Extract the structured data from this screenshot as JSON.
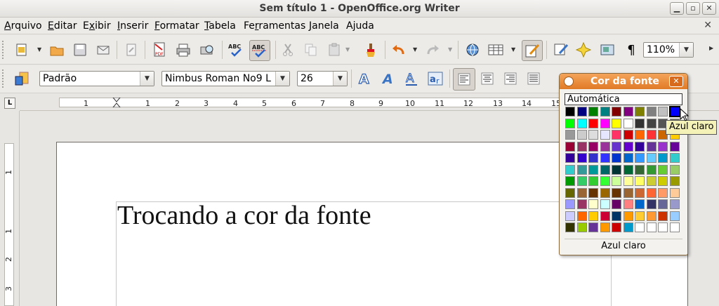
{
  "window": {
    "title": "Sem título 1 - OpenOffice.org Writer",
    "btn_min": "▁",
    "btn_max": "▫",
    "btn_close": "✕",
    "doc_close": "✕"
  },
  "menu": [
    {
      "label": "Arquivo",
      "accel": "A",
      "rest": "rquivo"
    },
    {
      "label": "Editar",
      "accel": "E",
      "rest": "ditar"
    },
    {
      "label": "Exibir",
      "accel": "x",
      "rest": "ibir"
    },
    {
      "label": "Inserir",
      "accel": "I",
      "rest": "nserir"
    },
    {
      "label": "Formatar",
      "accel": "F",
      "rest": "ormatar"
    },
    {
      "label": "Tabela",
      "accel": "T",
      "rest": "abela"
    },
    {
      "label": "Ferramentas",
      "accel": "r",
      "rest": "amentas"
    },
    {
      "label": "Janela",
      "accel": "J",
      "rest": "anela"
    },
    {
      "label": "Ajuda",
      "accel": "j",
      "rest": "uda"
    }
  ],
  "toolbar": {
    "zoom": "110%",
    "pilcrow": "¶"
  },
  "format": {
    "style": "Padrão",
    "font": "Nimbus Roman No9 L",
    "size": "26"
  },
  "ruler": {
    "marks": [
      "1",
      "1",
      "2",
      "3",
      "4",
      "5",
      "6",
      "7",
      "8",
      "9",
      "10",
      "11",
      "12",
      "13",
      "14",
      "15"
    ],
    "vmarks": [
      "1",
      "1",
      "2",
      "3"
    ]
  },
  "document": {
    "text": "Trocando a cor da fonte"
  },
  "popup": {
    "title": "Cor da fonte",
    "automatic": "Automática",
    "status": "Azul claro",
    "selected_index": 9,
    "colors": [
      "#000000",
      "#000080",
      "#008000",
      "#008080",
      "#800000",
      "#800080",
      "#808000",
      "#808080",
      "#c0c0c0",
      "#0000ff",
      "#00ff00",
      "#00ffff",
      "#ff0000",
      "#ff00ff",
      "#ffff00",
      "#ffffff",
      "#333333",
      "#444444",
      "#555555",
      "#666666",
      "#999999",
      "#cccccc",
      "#dddddd",
      "#e6e6ff",
      "#ff3366",
      "#cc0000",
      "#ff6600",
      "#ff3333",
      "#cc6600",
      "#ffcc00",
      "#990033",
      "#993366",
      "#990066",
      "#993399",
      "#6633cc",
      "#6600cc",
      "#330099",
      "#663399",
      "#9933cc",
      "#660099",
      "#330099",
      "#3300cc",
      "#3333cc",
      "#3333ff",
      "#0033cc",
      "#0066cc",
      "#3399ff",
      "#66ccff",
      "#0099cc",
      "#33cccc",
      "#33cccc",
      "#339999",
      "#009999",
      "#006666",
      "#003333",
      "#006633",
      "#336633",
      "#339933",
      "#66cc33",
      "#99cc66",
      "#009900",
      "#33cc66",
      "#33cc33",
      "#33ff33",
      "#ccff99",
      "#ffff99",
      "#ffff66",
      "#cccc33",
      "#cccc00",
      "#999900",
      "#666600",
      "#996633",
      "#663300",
      "#996600",
      "#663300",
      "#996633",
      "#cc6633",
      "#ff6633",
      "#ff9966",
      "#ffcc99",
      "#9999ff",
      "#993366",
      "#ffffcc",
      "#ccffff",
      "#660066",
      "#ff8080",
      "#0066cc",
      "#333366",
      "#666699",
      "#9999cc",
      "#ccccff",
      "#ff6600",
      "#ffcc00",
      "#cc0033",
      "#003366",
      "#ff9900",
      "#ffcc33",
      "#ff9933",
      "#cc3300",
      "#99ccff",
      "#333300",
      "#99cc00",
      "#663399",
      "#ff9900",
      "#cc0000",
      "#0099cc",
      "#ffffff",
      "#ffffff",
      "#ffffff",
      "#ffffff"
    ]
  },
  "tooltip": "Azul claro"
}
